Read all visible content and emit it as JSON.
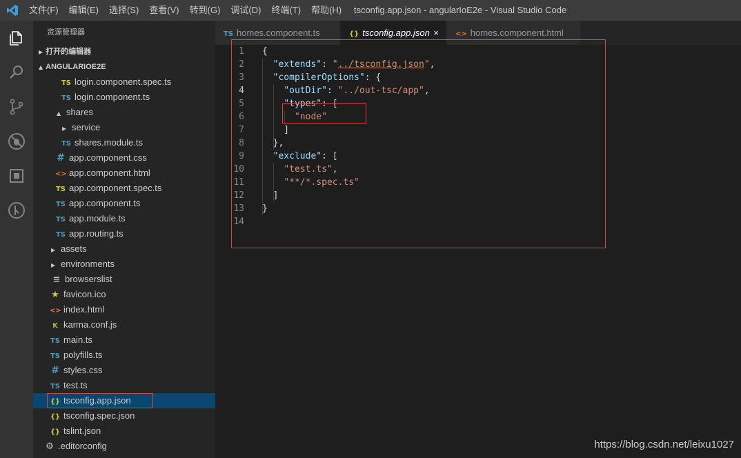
{
  "window": {
    "title": "tsconfig.app.json - angularIoE2e - Visual Studio Code",
    "menu": [
      "文件(F)",
      "编辑(E)",
      "选择(S)",
      "查看(V)",
      "转到(G)",
      "调试(D)",
      "终端(T)",
      "帮助(H)"
    ]
  },
  "activity_bar": {
    "icons": [
      "explorer-icon",
      "search-icon",
      "source-control-icon",
      "debug-icon",
      "extensions-icon",
      "git-graph-icon"
    ]
  },
  "sidebar": {
    "title": "资源管理器",
    "open_editors": "打开的编辑器",
    "project": "ANGULARIOE2E",
    "items": [
      {
        "label": "login.component.spec.ts",
        "icon": "TS",
        "type": "tsspec"
      },
      {
        "label": "login.component.ts",
        "icon": "TS",
        "type": "ts"
      },
      {
        "label": "shares",
        "icon": "▲",
        "type": "folder-open"
      },
      {
        "label": "service",
        "icon": "▶",
        "type": "folder"
      },
      {
        "label": "shares.module.ts",
        "icon": "TS",
        "type": "ts"
      },
      {
        "label": "app.component.css",
        "icon": "#",
        "type": "css"
      },
      {
        "label": "app.component.html",
        "icon": "<>",
        "type": "html"
      },
      {
        "label": "app.component.spec.ts",
        "icon": "TS",
        "type": "tsspec"
      },
      {
        "label": "app.component.ts",
        "icon": "TS",
        "type": "ts"
      },
      {
        "label": "app.module.ts",
        "icon": "TS",
        "type": "ts"
      },
      {
        "label": "app.routing.ts",
        "icon": "TS",
        "type": "ts"
      },
      {
        "label": "assets",
        "icon": "▶",
        "type": "folder"
      },
      {
        "label": "environments",
        "icon": "▶",
        "type": "folder"
      },
      {
        "label": "browserslist",
        "icon": "≡",
        "type": "lines"
      },
      {
        "label": "favicon.ico",
        "icon": "★",
        "type": "star"
      },
      {
        "label": "index.html",
        "icon": "<>",
        "type": "html"
      },
      {
        "label": "karma.conf.js",
        "icon": "K",
        "type": "karma"
      },
      {
        "label": "main.ts",
        "icon": "TS",
        "type": "ts"
      },
      {
        "label": "polyfills.ts",
        "icon": "TS",
        "type": "ts"
      },
      {
        "label": "styles.css",
        "icon": "#",
        "type": "css"
      },
      {
        "label": "test.ts",
        "icon": "TS",
        "type": "ts"
      },
      {
        "label": "tsconfig.app.json",
        "icon": "{}",
        "type": "json"
      },
      {
        "label": "tsconfig.spec.json",
        "icon": "{}",
        "type": "json"
      },
      {
        "label": "tslint.json",
        "icon": "{}",
        "type": "json"
      },
      {
        "label": ".editorconfig",
        "icon": "⚙",
        "type": "gear"
      }
    ]
  },
  "tabs": [
    {
      "label": "homes.component.ts",
      "icon": "TS"
    },
    {
      "label": "tsconfig.app.json",
      "icon": "{}",
      "close": "×"
    },
    {
      "label": "homes.component.html",
      "icon": "<>"
    }
  ],
  "editor": {
    "line_numbers": [
      "1",
      "2",
      "3",
      "4",
      "5",
      "6",
      "7",
      "8",
      "9",
      "10",
      "11",
      "12",
      "13",
      "14"
    ],
    "lines": [
      "{",
      "  \"extends\": \"../tsconfig.json\",",
      "  \"compilerOptions\": {",
      "    \"outDir\": \"../out-tsc/app\",",
      "    \"types\": [",
      "      \"node\"",
      "    ]",
      "  },",
      "  \"exclude\": [",
      "    \"test.ts\",",
      "    \"**/*.spec.ts\"",
      "  ]",
      "}",
      ""
    ]
  },
  "watermark": "https://blog.csdn.net/leixu1027"
}
